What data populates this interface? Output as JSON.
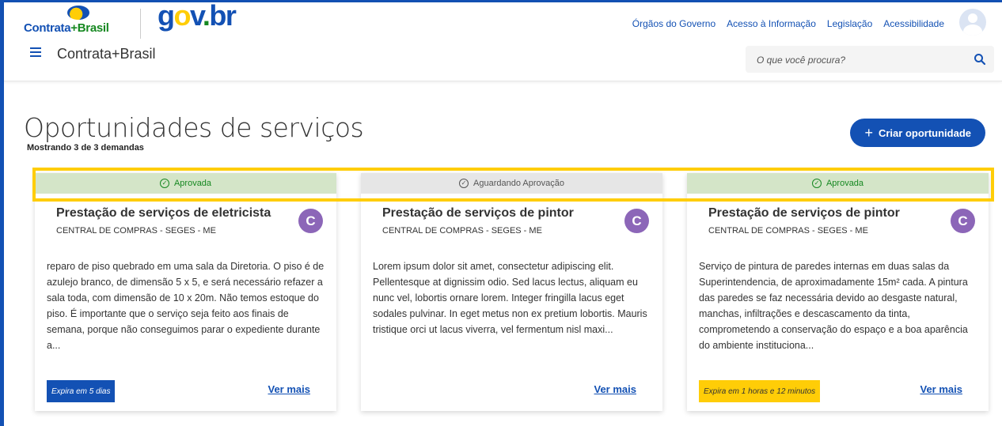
{
  "colors": {
    "primary": "#1351b4",
    "approved_bg": "#d4e5c8",
    "approved_text": "#168821",
    "pending_bg": "#e6e6e6",
    "highlight": "#ffcd07",
    "card_avatar": "#8c66b8"
  },
  "header": {
    "brand_logo": {
      "prefix": "Contrata",
      "plus": "+",
      "suffix": "Brasil"
    },
    "gov_logo": {
      "g": "g",
      "o": "o",
      "v": "v",
      "dot": ".",
      "br": "br"
    },
    "app_title": "Contrata+Brasil",
    "links": [
      "Órgãos do Governo",
      "Acesso à Informação",
      "Legislação",
      "Acessibilidade"
    ],
    "search": {
      "placeholder": "O que você procura?",
      "icon": "search-icon"
    },
    "menu_icon": "hamburger-menu-icon",
    "avatar_icon": "user-avatar-icon"
  },
  "main": {
    "title": "Oportunidades de serviços",
    "subtitle": "Mostrando 3 de 3 demandas",
    "create_button": {
      "icon": "+",
      "label": "Criar oportunidade"
    }
  },
  "cards": [
    {
      "status": "Aprovada",
      "status_type": "approved",
      "title": "Prestação de serviços de eletricista",
      "org": "CENTRAL DE COMPRAS - SEGES - ME",
      "avatar_letter": "C",
      "description": "reparo de piso quebrado em uma sala da Diretoria. O piso é de azulejo branco, de dimensão 5 x 5, e será necessário refazer a sala toda, com dimensão de 10 x 20m. Não temos estoque do piso. É importante que o serviço seja feito aos finais de semana, porque não conseguimos parar o expediente durante a...",
      "expiry": "Expira em 5 dias",
      "expiry_color": "blue",
      "link": "Ver mais"
    },
    {
      "status": "Aguardando Aprovação",
      "status_type": "pending",
      "title": "Prestação de serviços de pintor",
      "org": "CENTRAL DE COMPRAS - SEGES - ME",
      "avatar_letter": "C",
      "description": "Lorem ipsum dolor sit amet, consectetur adipiscing elit. Pellentesque at dignissim odio. Sed lacus lectus, aliquam eu nunc vel, lobortis ornare lorem. Integer fringilla lacus eget sodales pulvinar. In eget metus non ex pretium lobortis. Mauris tristique orci ut lacus viverra, vel fermentum nisl maxi...",
      "expiry": "",
      "expiry_color": "",
      "link": "Ver mais"
    },
    {
      "status": "Aprovada",
      "status_type": "approved",
      "title": "Prestação de serviços de pintor",
      "org": "CENTRAL DE COMPRAS - SEGES - ME",
      "avatar_letter": "C",
      "description": "Serviço de pintura de paredes internas em duas salas da Superintendencia, de aproximadamente 15m² cada. A pintura das paredes se faz necessária devido ao desgaste natural, manchas, infiltrações e descascamento da tinta, comprometendo a conservação do espaço e a boa aparência do ambiente instituciona...",
      "expiry": "Expira em 1 horas e 12 minutos",
      "expiry_color": "yellow",
      "link": "Ver mais"
    }
  ]
}
